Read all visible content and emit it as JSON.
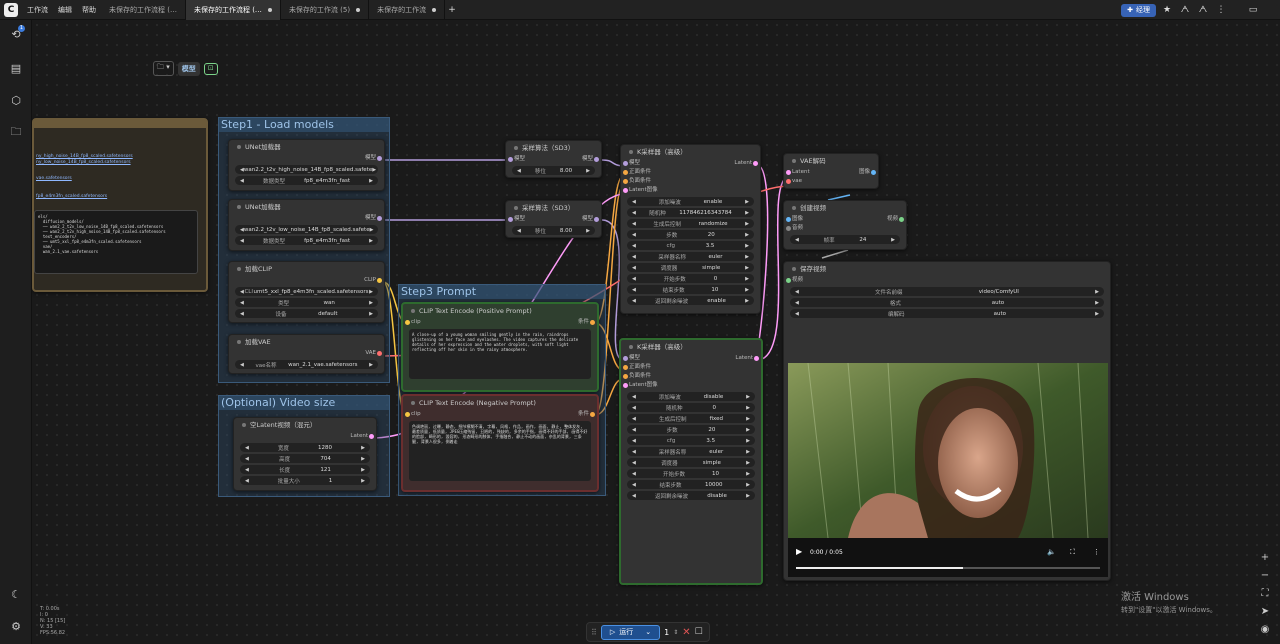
{
  "menu": {
    "logo": "C",
    "workflow": "工作流",
    "edit": "编辑",
    "help": "帮助"
  },
  "tabs": [
    {
      "label": "未保存的工作流程 (…"
    },
    {
      "label": "未保存的工作流程 (…"
    },
    {
      "label": "未保存的工作流 (5)"
    },
    {
      "label": "未保存的工作流"
    }
  ],
  "topright": {
    "manager": "经理"
  },
  "sidebar": {
    "badge": "1"
  },
  "toolbar": {
    "folder": "▾",
    "model_label": "模型"
  },
  "stats": {
    "t": "T: 0.00s",
    "i": "I: 0",
    "n": "N: 15 [15]",
    "v": "V: 33",
    "fps": "FPS:56.82"
  },
  "groups": {
    "g1": "Step1 - Load models",
    "g3": "Step3 Prompt",
    "gv": "(Optional) Video size"
  },
  "note": {
    "lines": [
      "ny_high_noise_14B_fp8_scaled.safetensors",
      "ny_low_noise_14B_fp8_scaled.safetensors",
      "vae.safetensors",
      "fp8_e4m3fn_scaled.safetensors"
    ],
    "tree": "els/\n  diffusion_models/\n  ── wan2_2_t2v_low_noise_14B_fp8_scaled.safetensors\n  ── wan2_2_t2v_high_noise_14B_fp8_scaled.safetensors\n  text_encoders/\n  ── umt5_xxl_fp8_e4m3fn_scaled.safetensors\n  vae/\n  wan_2.1_vae.safetensors"
  },
  "unet1": {
    "title": "UNet加载器",
    "out": "模型",
    "name": "wan2.2_t2v_high_noise_14B_fp8_scaled.safete",
    "dtype_label": "数据类型",
    "dtype": "fp8_e4m3fn_fast"
  },
  "unet2": {
    "title": "UNet加载器",
    "out": "模型",
    "name": "wan2.2_t2v_low_noise_14B_fp8_scaled.safete",
    "dtype_label": "数据类型",
    "dtype": "fp8_e4m3fn_fast"
  },
  "clip": {
    "title": "加载CLIP",
    "out": "CLIP",
    "name_label": "CLI",
    "name": "umt5_xxl_fp8_e4m3fn_scaled.safetensors",
    "type_label": "类型",
    "type": "wan",
    "dev_label": "设备",
    "dev": "default"
  },
  "vae": {
    "title": "加载VAE",
    "out": "VAE",
    "name_label": "vae名称",
    "name": "wan_2.1_vae.safetensors"
  },
  "latent": {
    "title": "空Latent视频（混元）",
    "out": "Latent",
    "w_l": "宽度",
    "w": "1280",
    "h_l": "高度",
    "h": "704",
    "len_l": "长度",
    "len": "121",
    "b_l": "批量大小",
    "b": "1"
  },
  "pos": {
    "title": "CLIP Text Encode (Positive Prompt)",
    "in": "clip",
    "out": "条件",
    "text": "A close-up of a young woman smiling gently in the rain, raindrops glistening on her face and eyelashes. The video captures the delicate details of her expression and the water droplets, with soft light reflecting off her skin in the rainy atmosphere."
  },
  "neg": {
    "title": "CLIP Text Encode (Negative Prompt)",
    "in": "clip",
    "out": "条件",
    "text": "色调艳丽, 过曝, 静态, 细节模糊不清, 字幕, 风格, 作品, 画作, 画面, 静止, 整体发灰, 最差质量, 低质量, JPEG压缩残留, 丑陋的, 残缺的, 多余的手指, 画得不好的手部, 画得不好的脸部, 畸形的, 毁容的, 形态畸形的肢体, 手指融合, 静止不动的画面, 杂乱的背景, 三条腿, 背景人很多, 倒着走"
  },
  "ms1": {
    "title": "采样算法（SD3）",
    "in": "模型",
    "out": "模型",
    "s_l": "移位",
    "s": "8.00"
  },
  "ms2": {
    "title": "采样算法（SD3）",
    "in": "模型",
    "out": "模型",
    "s_l": "移位",
    "s": "8.00"
  },
  "k1": {
    "title": "K采样器（高级）",
    "in_model": "模型",
    "out": "Latent",
    "in_pos": "正面条件",
    "in_neg": "负面条件",
    "in_lat": "Latent图像",
    "rows": [
      [
        "添加噪波",
        "enable"
      ],
      [
        "随机种",
        "117846216343784"
      ],
      [
        "生成后控制",
        "randomize"
      ],
      [
        "步数",
        "20"
      ],
      [
        "cfg",
        "3.5"
      ],
      [
        "采样器名称",
        "euler"
      ],
      [
        "调度器",
        "simple"
      ],
      [
        "开始步数",
        "0"
      ],
      [
        "结束步数",
        "10"
      ],
      [
        "返回剩余噪波",
        "enable"
      ]
    ]
  },
  "k2": {
    "title": "K采样器（高级）",
    "in_model": "模型",
    "out": "Latent",
    "in_pos": "正面条件",
    "in_neg": "负面条件",
    "in_lat": "Latent图像",
    "rows": [
      [
        "添加噪波",
        "disable"
      ],
      [
        "随机种",
        "0"
      ],
      [
        "生成后控制",
        "fixed"
      ],
      [
        "步数",
        "20"
      ],
      [
        "cfg",
        "3.5"
      ],
      [
        "采样器名称",
        "euler"
      ],
      [
        "调度器",
        "simple"
      ],
      [
        "开始步数",
        "10"
      ],
      [
        "结束步数",
        "10000"
      ],
      [
        "返回剩余噪波",
        "disable"
      ]
    ]
  },
  "vaedec": {
    "title": "VAE解码",
    "in1": "Latent",
    "in2": "vae",
    "out": "图像"
  },
  "create": {
    "title": "创建视频",
    "in1": "图像",
    "in2": "音频",
    "out": "视频",
    "fps_l": "帧率",
    "fps": "24"
  },
  "save": {
    "title": "保存视频",
    "in": "视频",
    "prefix_l": "文件名前缀",
    "prefix": "video/ComfyUI",
    "fmt_l": "格式",
    "fmt": "auto",
    "codec_l": "编解码",
    "codec": "auto"
  },
  "player": {
    "time": "0:00 / 0:05",
    "progress": 0.55
  },
  "run": {
    "label": "运行",
    "count": "1"
  },
  "watermark": {
    "line1": "激活 Windows",
    "line2": "转到\"设置\"以激活 Windows。"
  },
  "colors": {
    "accent": "#3763b6",
    "model": "#b39ddb",
    "clip": "#f5c542",
    "cond": "#f5a742",
    "latent": "#ff9cf9",
    "vae": "#ff6e6e",
    "image": "#64b5f6",
    "video": "#7bd389"
  }
}
